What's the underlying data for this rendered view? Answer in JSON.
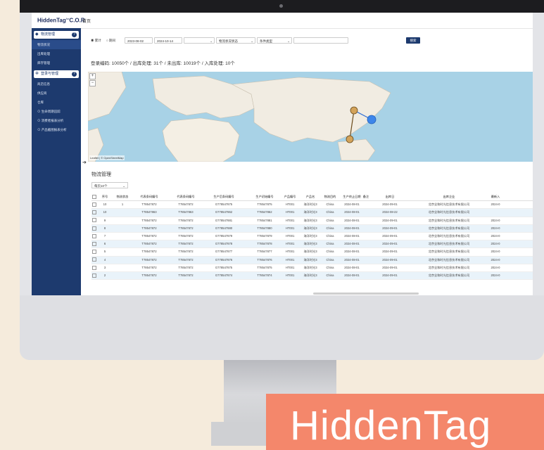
{
  "app": {
    "logo": "HiddenTag",
    "logo_sup": "for",
    "logo_suffix": "C.O.R",
    "home_tab": "首页"
  },
  "sidebar": {
    "groups": [
      {
        "label": "物流管理",
        "help": "?",
        "items": [
          {
            "label": "物流状况",
            "active": true
          },
          {
            "label": "出库处理"
          },
          {
            "label": "库存管理"
          }
        ]
      },
      {
        "label": "登录与管理",
        "help": "?",
        "items": [
          {
            "label": "商店信息"
          },
          {
            "label": "供应商"
          },
          {
            "label": "仓库"
          },
          {
            "label": "生命周期追踪"
          },
          {
            "label": "消费者报表分析"
          },
          {
            "label": "产品截图报表分析"
          }
        ]
      }
    ]
  },
  "filters": {
    "radio_all": "累计",
    "radio_period": "期间",
    "date_from": "2023-08-02",
    "date_to": "2024-10-14",
    "status_placeholder": "物流状况状态",
    "type_placeholder": "条件类型",
    "search_button": "搜索"
  },
  "summary": "登录编码: 10050个 / 出库处理: 31个 / 未出库: 10019个 / 入库处理: 10个",
  "map": {
    "credit": "Leaflet | © OpenStreetMap"
  },
  "logistics": {
    "title": "物流管理",
    "page_size": "每页10个",
    "columns": [
      "序号",
      "物流状态",
      "代表条码编号",
      "代表条码编号",
      "生产后条码编号",
      "生产初始编号",
      "产品编号",
      "产品名",
      "物流目的",
      "生产终止日期",
      "备注",
      "出库日",
      "出库企业",
      "最新入"
    ],
    "rows": [
      [
        "10",
        "1",
        "T78547872",
        "T78547872",
        "G778547875",
        "T78547875",
        "HT001",
        "海洋时光3",
        "China",
        "2024-08-01",
        "",
        "2024-09-01",
        "北京全和时光信息技术有限公司",
        "2024-0"
      ],
      [
        "10",
        "",
        "T78547863",
        "T78547863",
        "G778547862",
        "T78547862",
        "HT001",
        "海洋时光3",
        "China",
        "2024-08-01",
        "",
        "2024-08-22",
        "北京全和时光信息技术有限公司",
        ""
      ],
      [
        "9",
        "",
        "T78547872",
        "T78547872",
        "G778547881",
        "T78547881",
        "HT001",
        "海洋时光3",
        "China",
        "2024-08-01",
        "",
        "2024-09-01",
        "北京全和时光信息技术有限公司",
        "2024-0"
      ],
      [
        "8",
        "",
        "T78547872",
        "T78547872",
        "G778547880",
        "T78547880",
        "HT001",
        "海洋时光3",
        "China",
        "2024-08-01",
        "",
        "2024-09-01",
        "北京全和时光信息技术有限公司",
        "2024-0"
      ],
      [
        "7",
        "",
        "T78547872",
        "T78547872",
        "G778547879",
        "T78547879",
        "HT001",
        "海洋时光3",
        "China",
        "2024-08-01",
        "",
        "2024-09-01",
        "北京全和时光信息技术有限公司",
        "2024-0"
      ],
      [
        "6",
        "",
        "T78547872",
        "T78547872",
        "G778547878",
        "T78547878",
        "HT001",
        "海洋时光3",
        "China",
        "2024-08-01",
        "",
        "2024-09-01",
        "北京全和时光信息技术有限公司",
        "2024-0"
      ],
      [
        "5",
        "",
        "T78547872",
        "T78547872",
        "G778547877",
        "T78547877",
        "HT001",
        "海洋时光3",
        "China",
        "2024-08-01",
        "",
        "2024-09-01",
        "北京全和时光信息技术有限公司",
        "2024-0"
      ],
      [
        "4",
        "",
        "T78547872",
        "T78547872",
        "G778547876",
        "T78547876",
        "HT001",
        "海洋时光3",
        "China",
        "2024-08-01",
        "",
        "2024-09-01",
        "北京全和时光信息技术有限公司",
        "2024-0"
      ],
      [
        "3",
        "",
        "T78547872",
        "T78547872",
        "G778547875",
        "T78547875",
        "HT001",
        "海洋时光3",
        "China",
        "2024-08-01",
        "",
        "2024-09-01",
        "北京全和时光信息技术有限公司",
        "2024-0"
      ],
      [
        "2",
        "",
        "T78547872",
        "T78547872",
        "G778547874",
        "T78547874",
        "HT001",
        "海洋时光3",
        "China",
        "2024-08-01",
        "",
        "2024-09-01",
        "北京全和时光信息技术有限公司",
        "2024-0"
      ]
    ]
  },
  "banner": {
    "text": "HiddenTag"
  },
  "colors": {
    "sidebar": "#1d3a6e",
    "banner": "#f4876b",
    "map_water": "#a8d2e6"
  }
}
